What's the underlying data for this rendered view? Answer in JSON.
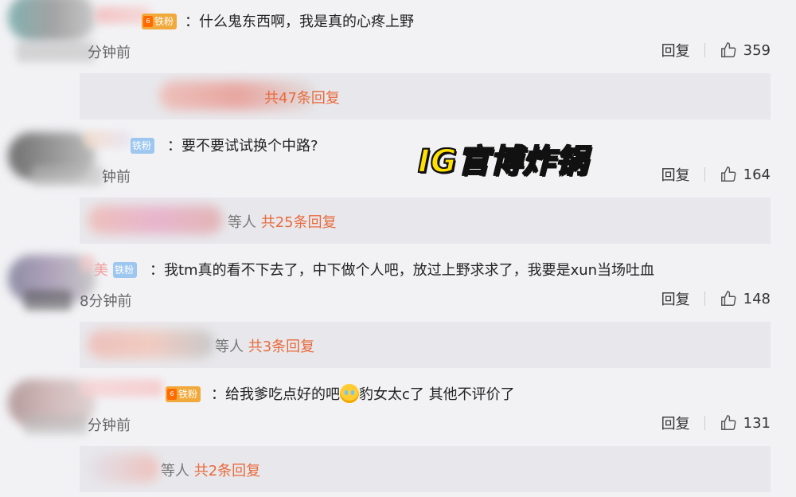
{
  "headline": "IG官博炸锅",
  "comments": [
    {
      "badge": "铁粉",
      "text": "：什么鬼东西啊，我是真的心疼上野",
      "time": "分钟前",
      "reply_label": "回复",
      "likes": "359",
      "replies_prefix": "",
      "replies_link": "共47条回复",
      "badge_color": "#f2a93b"
    },
    {
      "badge": "铁粉",
      "text": "：要不要试试换个中路?",
      "time": "钟前",
      "reply_label": "回复",
      "likes": "164",
      "replies_prefix": "等人",
      "replies_link": "共25条回复",
      "badge_color": "#9ec7ef"
    },
    {
      "name_fragment": "美",
      "badge": "铁粉",
      "text": "：我tm真的看不下去了，中下做个人吧，放过上野求求了，我要是xun当场吐血",
      "time": "8分钟前",
      "reply_label": "回复",
      "likes": "148",
      "replies_prefix": "等人",
      "replies_link": "共3条回复",
      "badge_color": "#9ec7ef"
    },
    {
      "badge": "铁粉",
      "text_before_emoji": "：给我爹吃点好的吧",
      "text_after_emoji": "豹女太c了 其他不评价了",
      "emoji_name": "crying-emoji",
      "time": "分钟前",
      "reply_label": "回复",
      "likes": "131",
      "replies_prefix": "等人",
      "replies_link": "共2条回复",
      "badge_color": "#f2a93b"
    }
  ]
}
